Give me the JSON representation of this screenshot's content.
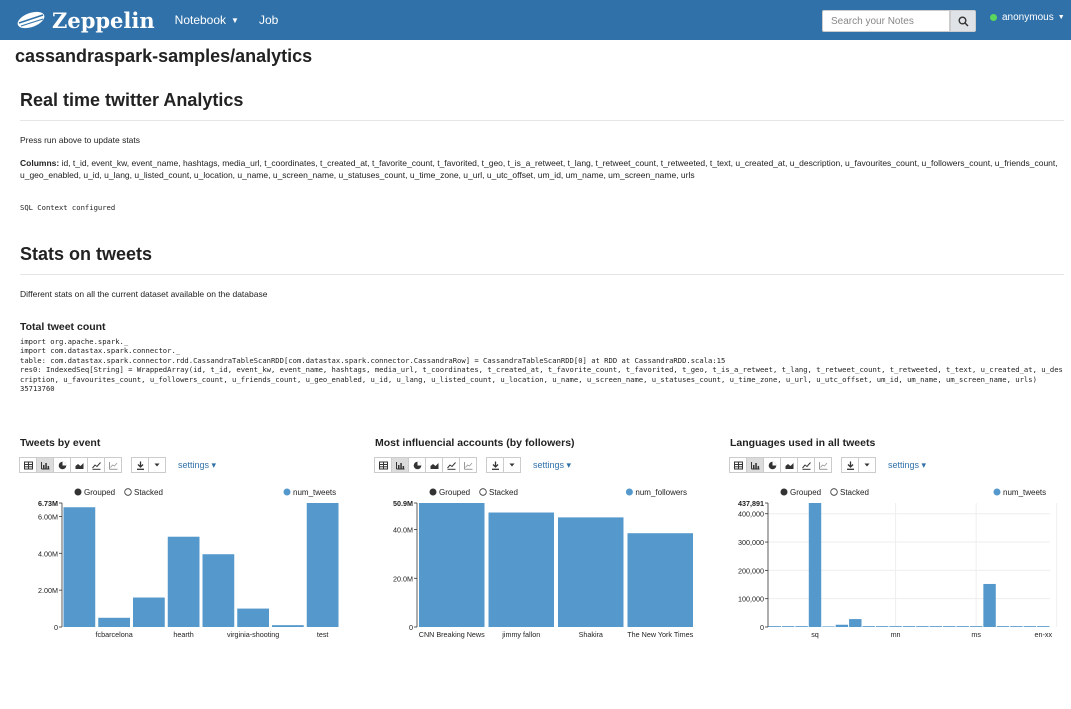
{
  "nav": {
    "brand": "Zeppelin",
    "notebook": "Notebook",
    "job": "Job",
    "search_placeholder": "Search your Notes",
    "user": "anonymous"
  },
  "notebook_title": "cassandraspark-samples/analytics",
  "section1": {
    "title": "Real time twitter Analytics",
    "subtitle": "Press run above to update stats",
    "columns_label": "Columns:",
    "columns": " id, t_id, event_kw, event_name, hashtags, media_url, t_coordinates, t_created_at, t_favorite_count, t_favorited, t_geo, t_is_a_retweet, t_lang, t_retweet_count, t_retweeted, t_text, u_created_at, u_description, u_favourites_count, u_followers_count, u_friends_count, u_geo_enabled, u_id, u_lang, u_listed_count, u_location, u_name, u_screen_name, u_statuses_count, u_time_zone, u_url, u_utc_offset, um_id, um_name, um_screen_name, urls",
    "output": "SQL Context configured"
  },
  "section2": {
    "title": "Stats on tweets",
    "subtitle": "Different stats on all the current dataset available on the database",
    "subheading": "Total tweet count",
    "code": "import org.apache.spark._\nimport com.datastax.spark.connector._\ntable: com.datastax.spark.connector.rdd.CassandraTableScanRDD[com.datastax.spark.connector.CassandraRow] = CassandraTableScanRDD[0] at RDD at CassandraRDD.scala:15\nres0: IndexedSeq[String] = WrappedArray(id, t_id, event_kw, event_name, hashtags, media_url, t_coordinates, t_created_at, t_favorite_count, t_favorited, t_geo, t_is_a_retweet, t_lang, t_retweet_count, t_retweeted, t_text, u_created_at, u_description, u_favourites_count, u_followers_count, u_friends_count, u_geo_enabled, u_id, u_lang, u_listed_count, u_location, u_name, u_screen_name, u_statuses_count, u_time_zone, u_url, u_utc_offset, um_id, um_name, um_screen_name, urls)\n35713760"
  },
  "colors": {
    "accent": "#3071a9",
    "bar": "#5599cc"
  },
  "chart_data": [
    {
      "type": "bar",
      "title": "Tweets by event",
      "series": [
        {
          "name": "num_tweets",
          "values": [
            6.5,
            0.5,
            1.6,
            4.9,
            3.95,
            1.0,
            0.1,
            6.73
          ]
        }
      ],
      "categories": [
        "",
        "fcbarcelona",
        "",
        "hearth",
        "",
        "virginia-shooting",
        "",
        "test"
      ],
      "ytick_values": [
        0,
        2,
        4,
        6,
        6.73
      ],
      "ytick_labels": [
        "0",
        "2.00M",
        "4.00M",
        "6.00M",
        "6.73M"
      ],
      "ylim": [
        0,
        6.73
      ],
      "legend": {
        "grouped": "Grouped",
        "stacked": "Stacked"
      },
      "settings": "settings"
    },
    {
      "type": "bar",
      "title": "Most influencial accounts (by followers)",
      "series": [
        {
          "name": "num_followers",
          "values": [
            50.9,
            47.0,
            45.0,
            38.5
          ]
        }
      ],
      "categories": [
        "CNN Breaking News",
        "jimmy fallon",
        "Shakira",
        "The New York Times"
      ],
      "ytick_values": [
        0,
        20,
        40,
        50.9
      ],
      "ytick_labels": [
        "0",
        "20.0M",
        "40.0M",
        "50.9M"
      ],
      "ylim": [
        0,
        50.9
      ],
      "legend": {
        "grouped": "Grouped",
        "stacked": "Stacked"
      },
      "settings": "settings"
    },
    {
      "type": "bar",
      "title": "Languages used in all tweets",
      "series": [
        {
          "name": "num_tweets",
          "values": [
            3000,
            3000,
            3000,
            437891,
            2000,
            8000,
            28000,
            3000,
            3000,
            3000,
            3000,
            3000,
            3000,
            3000,
            3000,
            3000,
            152000,
            3000,
            3000,
            3000,
            3000
          ]
        }
      ],
      "categories": [
        "",
        "",
        "",
        "sq",
        "",
        "",
        "",
        "",
        "",
        "mn",
        "",
        "",
        "",
        "",
        "",
        "ms",
        "",
        "",
        "",
        "",
        "en-xx"
      ],
      "ytick_values": [
        0,
        100000,
        200000,
        300000,
        400000,
        437891
      ],
      "ytick_labels": [
        "0",
        "100,000",
        "200,000",
        "300,000",
        "400,000",
        "437,891"
      ],
      "ylim": [
        0,
        437891
      ],
      "legend": {
        "grouped": "Grouped",
        "stacked": "Stacked"
      },
      "settings": "settings"
    }
  ]
}
